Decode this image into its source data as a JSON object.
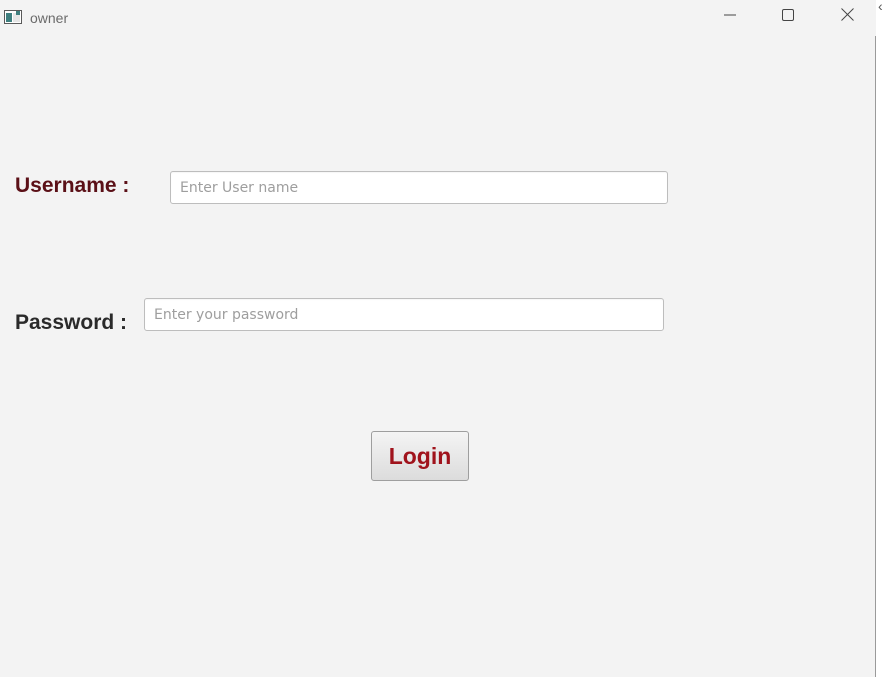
{
  "window": {
    "title": "owner",
    "icon": "app-window-icon",
    "controls": [
      "minimize-icon",
      "maximize-icon",
      "close-icon"
    ]
  },
  "form": {
    "username_label": "Username :",
    "username_placeholder": "Enter User name",
    "username_value": "",
    "password_label": "Password :",
    "password_placeholder": "Enter your password",
    "password_value": "",
    "login_label": "Login"
  },
  "colors": {
    "window_background": "#f3f3f3",
    "username_label": "#5b1017",
    "password_label": "#2a2a2a",
    "login_text": "#a0131c"
  }
}
